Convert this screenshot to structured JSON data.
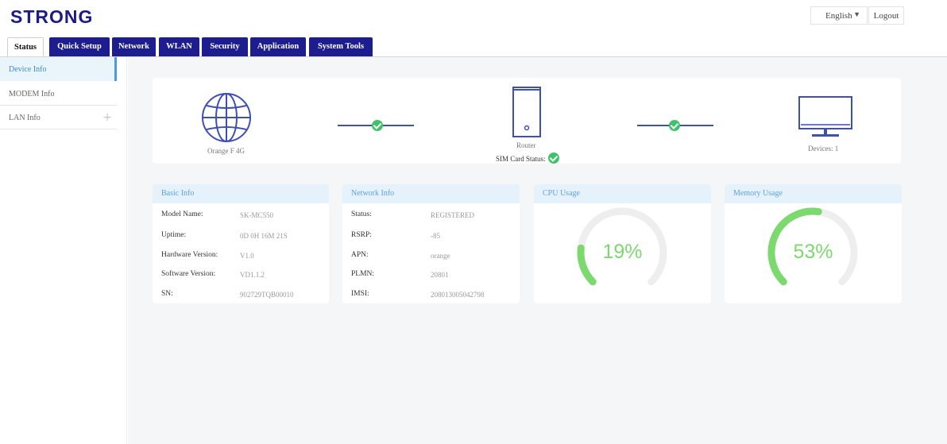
{
  "brand": {
    "logo_text": "STRONG"
  },
  "header": {
    "language": "English",
    "logout_label": "Logout"
  },
  "tabs": [
    "Status",
    "Quick Setup",
    "Network",
    "WLAN",
    "Security",
    "Application",
    "System Tools"
  ],
  "sidebar": {
    "items": [
      "Device Info",
      "MODEM Info",
      "LAN Info"
    ]
  },
  "topology": {
    "internet_label": "Orange F 4G",
    "router_label": "Router",
    "sim_status_label": "SIM Card Status:",
    "devices_label": "Devices: 1"
  },
  "basic_info": {
    "title": "Basic Info",
    "rows": [
      {
        "label": "Model Name:",
        "value": "SK-MC550"
      },
      {
        "label": "Uptime:",
        "value": "0D 0H 16M 21S"
      },
      {
        "label": "Hardware Version:",
        "value": "V1.0"
      },
      {
        "label": "Software Version:",
        "value": "VD1.1.2"
      },
      {
        "label": "SN:",
        "value": "902729TQB00010"
      }
    ]
  },
  "network_info": {
    "title": "Network Info",
    "rows": [
      {
        "label": "Status:",
        "value": "REGISTERED"
      },
      {
        "label": "RSRP:",
        "value": "-85"
      },
      {
        "label": "APN:",
        "value": "orange"
      },
      {
        "label": "PLMN:",
        "value": "20801"
      },
      {
        "label": "IMSI:",
        "value": "208013005042798"
      }
    ]
  },
  "cpu": {
    "title": "CPU Usage",
    "percent": 19,
    "display": "19%"
  },
  "memory": {
    "title": "Memory Usage",
    "percent": 53,
    "display": "53%"
  },
  "colors": {
    "nav": "#1d1d8f",
    "accent": "#4a9be3",
    "ok": "#3fc36a",
    "gauge": "#7bd96e",
    "gauge_track": "#eeeeee"
  },
  "icons": [
    "globe-icon",
    "router-icon",
    "monitor-icon",
    "check-icon",
    "chevron-down-icon",
    "plus-icon"
  ]
}
